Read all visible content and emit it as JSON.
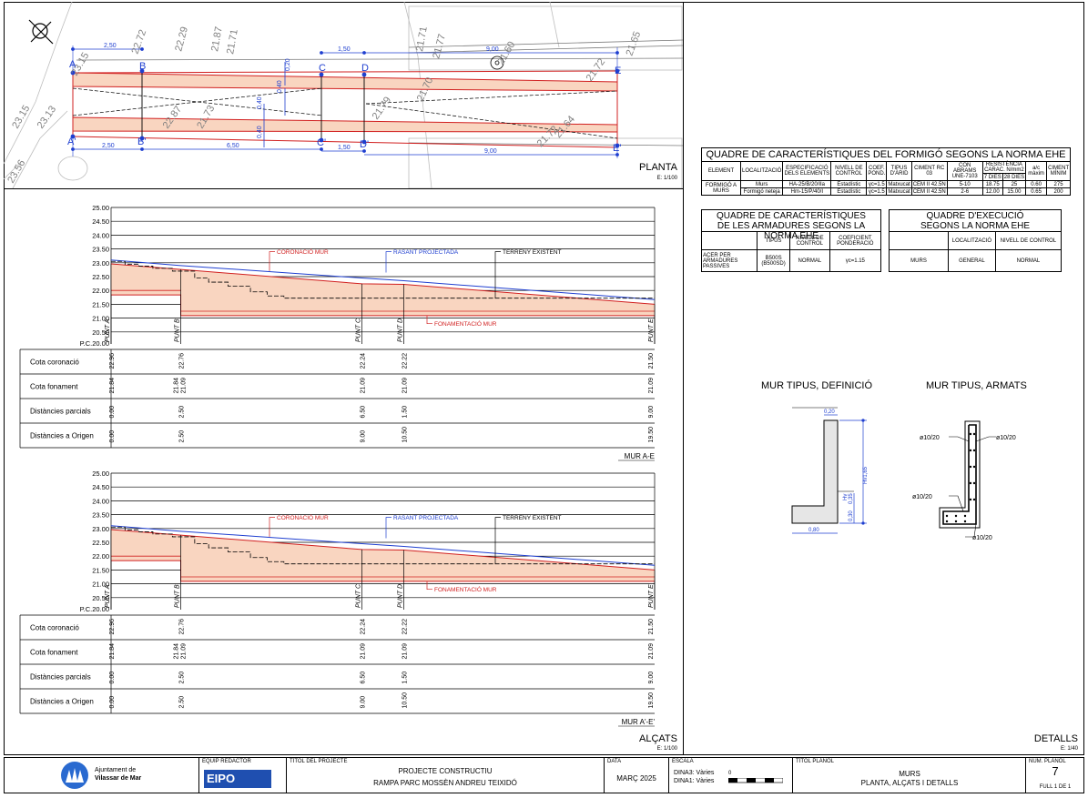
{
  "plan": {
    "title": "PLANTA",
    "scale": "E: 1/100",
    "points_top": [
      "A",
      "B",
      "C",
      "D",
      "E"
    ],
    "points_bottom": [
      "A'",
      "B'",
      "C'",
      "D'",
      "E'"
    ],
    "dims_top": [
      "2,50",
      "1,50",
      "9,00"
    ],
    "dims_bottom": [
      "2,50",
      "6,50",
      "1,50",
      "9,00"
    ],
    "small_dims": [
      "0,20",
      "0,40",
      "0,40",
      "0,40"
    ],
    "contours": [
      "23.15",
      "22.72",
      "22.29",
      "21.87",
      "21.71",
      "21.71",
      "21.77",
      "21.65",
      "23.15",
      "23.13",
      "22.87",
      "21.73",
      "21.60",
      "21.72",
      "21.64",
      "21.72",
      "23.56",
      "21.79",
      "21.70"
    ]
  },
  "sections": {
    "title": "ALÇATS",
    "scale": "E: 1/100",
    "y_ticks": [
      "25.00",
      "24.50",
      "24.00",
      "23.50",
      "23.00",
      "22.50",
      "22.00",
      "21.50",
      "21.00",
      "20.50"
    ],
    "datum": "P.C.20.00",
    "labels": {
      "coronacio": "CORONACIÓ MUR",
      "rasant": "RASANT PROJECTADA",
      "terreny": "TERRENY EXISTENT",
      "fonamentacio": "FONAMENTACIÓ MUR"
    },
    "points": [
      "PUNT A",
      "PUNT B",
      "PUNT C",
      "PUNT D",
      "PUNT E"
    ],
    "row_labels": [
      "Cota coronació",
      "Cota fonament",
      "Distàncies parcials",
      "Distàncies a Origen"
    ],
    "profile1": {
      "name": "MUR A-E",
      "coronacio": [
        "22.96",
        "22.76",
        "22.24",
        "22.22",
        "21.50"
      ],
      "fonament": [
        "21.84",
        "21.84",
        "21.09",
        "21.09",
        "21.09",
        "21.09"
      ],
      "parcials": [
        "0.00",
        "2.50",
        "6.50",
        "1.50",
        "9.00"
      ],
      "origen": [
        "0.00",
        "2.50",
        "9.00",
        "10.50",
        "19.50"
      ]
    },
    "profile2": {
      "name": "MUR A'-E'",
      "coronacio": [
        "22.96",
        "22.76",
        "22.24",
        "22.22",
        "21.50"
      ],
      "fonament": [
        "21.84",
        "21.84",
        "21.09",
        "21.09",
        "21.09",
        "21.09"
      ],
      "parcials": [
        "0.00",
        "2.50",
        "6.50",
        "1.50",
        "9.00"
      ],
      "origen": [
        "0.00",
        "2.50",
        "9.00",
        "10.50",
        "19.50"
      ]
    }
  },
  "quadre_formigo": {
    "title": "QUADRE DE CARACTERÍSTIQUES DEL FORMIGÓ SEGONS LA NORMA EHE",
    "headers": [
      "ELEMENT",
      "LOCALITZACIÓ",
      "ESPECIFICACIÓ DELS ELEMENTS",
      "NIVELL DE CONTROL",
      "COEF. POND.",
      "TIPUS D'ÀRID",
      "CIMENT RC 03",
      "CON ABRAMS UNE-7103",
      "RESISTÈNCIA CARAC. N/mm2",
      "a/c màxim",
      "CIMENT MÍNIM"
    ],
    "sub_headers": [
      "7 DIES",
      "28 DIES"
    ],
    "element": "FORMIGÓ A MURS",
    "rows": [
      [
        "Murs",
        "HA-25/B/20/IIa",
        "Estadístic",
        "γc=1.5",
        "Matxucat",
        "CEM II 42.5N",
        "5-10",
        "18.75",
        "25",
        "0.60",
        "275"
      ],
      [
        "Formigó neteja",
        "Hm-15/P/40/I",
        "Estadístic",
        "γc=1.5",
        "Matxucat",
        "CEM II 42.5N",
        "2-6",
        "12.00",
        "15.00",
        "0.65",
        "200"
      ]
    ]
  },
  "quadre_armadures": {
    "title": "QUADRE DE CARACTERÍSTIQUES DE LES ARMADURES SEGONS LA NORMA EHE",
    "headers": [
      "TIPUS",
      "NIVELL DE CONTROL",
      "COEFICIENT PONDERACIÓ"
    ],
    "row": [
      "ACER PER ARMADURES PASSIVES",
      "B500S (B500SD)",
      "NORMAL",
      "γc=1.15"
    ]
  },
  "quadre_execucio": {
    "title": "QUADRE D'EXECUCIÓ SEGONS LA NORMA EHE",
    "headers": [
      "LOCALITZACIÓ",
      "NIVELL DE CONTROL"
    ],
    "row": [
      "MURS",
      "GENERAL",
      "NORMAL"
    ]
  },
  "details": {
    "title": "DETALLS",
    "scale": "E: 1/40",
    "def_title": "MUR TIPUS, DEFINICIÓ",
    "arm_title": "MUR TIPUS, ARMATS",
    "def_dims": [
      "0,20",
      "Hv1,65",
      "Hv",
      "0,35",
      "0,30",
      "0,80"
    ],
    "bars": [
      "ø10/20",
      "ø10/20",
      "ø10/20",
      "ø10/20"
    ]
  },
  "titleblock": {
    "municipality_line1": "Ajuntament de",
    "municipality_line2": "Vilassar de Mar",
    "team_label": "EQUIP REDACTOR",
    "team_logo": "EIPO",
    "project_label": "TÍTOL DEL PROJECTE",
    "project_line1": "PROJECTE CONSTRUCTIU",
    "project_line2": "RAMPA PARC MOSSÈN ANDREU TEIXIDÓ",
    "date_label": "DATA",
    "date": "MARÇ 2025",
    "scale_label": "ESCALA",
    "scale_a3": "DINA3: Vàries",
    "scale_a1": "DINA1: Vàries",
    "scale_zero": "0",
    "plan_title_label": "TÍTOL PLÀNOL",
    "plan_title1": "MURS",
    "plan_title2": "PLANTA, ALÇATS I DETALLS",
    "plan_num_label": "NÚM. PLÀNOL",
    "plan_num": "7",
    "sheet": "FULL 1 DE 1"
  }
}
